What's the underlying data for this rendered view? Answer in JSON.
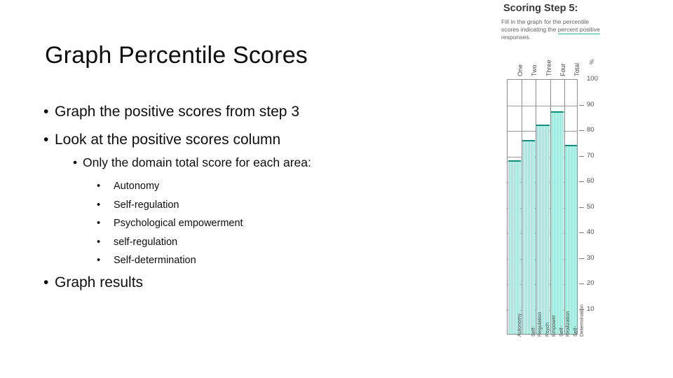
{
  "slide": {
    "title": "Graph Percentile Scores",
    "bullets": [
      {
        "level": 1,
        "text": "Graph the positive scores from step 3"
      },
      {
        "level": 1,
        "text": "Look at the positive scores column"
      },
      {
        "level": 2,
        "text": "Only the domain total score for each area:"
      }
    ],
    "bullet_1": "Graph the positive scores from step 3",
    "bullet_2": "Look at the positive scores column",
    "bullet_sub": "Only the domain total score for each area:",
    "bullet_last": "Graph results",
    "sub_items": [
      "Autonomy",
      "Self-regulation",
      "Psychological empowerment",
      "self-regulation",
      "Self-determination"
    ],
    "bullet_glyph": "•"
  },
  "worksheet": {
    "title": "Scoring Step 5:",
    "instruction_prefix": "Fill in the graph for the percentile scores indicating the ",
    "instruction_highlight": "percent positive",
    "instruction_suffix": " responses.",
    "percent_symbol": "%",
    "column_headers": [
      "One",
      "Two",
      "Three",
      "Four",
      "Total"
    ],
    "ink_color": "#2ab5a5",
    "bar_fill_color": "#a5e9e0",
    "bar_edge_color": "#0f8f82"
  },
  "chart_data": {
    "type": "bar",
    "title": "Scoring Step 5:",
    "categories": [
      "Autonomy",
      "Self-Regulation",
      "Psych Empower",
      "Self-Realization",
      "Self-Determination"
    ],
    "column_labels": [
      "One",
      "Two",
      "Three",
      "Four",
      "Total"
    ],
    "values": [
      68,
      76,
      82,
      87,
      74
    ],
    "xlabel": "",
    "ylabel": "%",
    "ylim": [
      0,
      100
    ],
    "yticks": [
      100,
      90,
      80,
      70,
      60,
      50,
      40,
      30,
      20,
      10
    ],
    "grid": true,
    "legend": "none"
  }
}
